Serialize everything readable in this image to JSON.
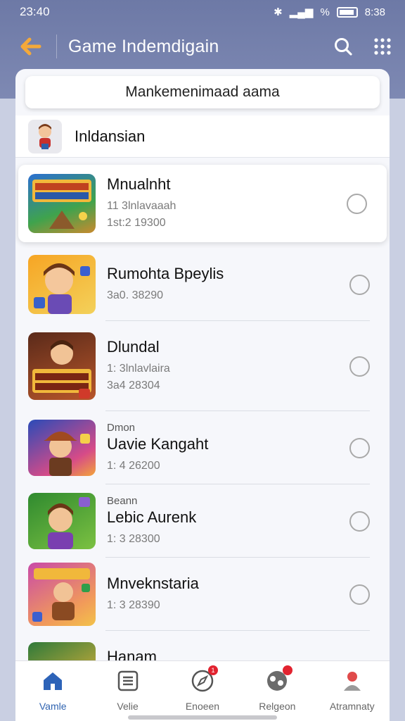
{
  "status_bar": {
    "time_left": "23:40",
    "signal_text": "%",
    "time_right": "8:38"
  },
  "app_bar": {
    "back_icon": "arrow-left-icon",
    "title": "Game Indemdigain",
    "search_icon": "search-icon",
    "grid_icon": "grid-icon",
    "accent": "#f4a93a"
  },
  "search": {
    "value": "Mankemenimaad aama"
  },
  "category": {
    "label": "Inldansian"
  },
  "games": [
    {
      "pre": "",
      "name": "Mnualnht",
      "meta1": "11 3lnlavaaah",
      "meta2": "1st:2 19300",
      "selected": true
    },
    {
      "pre": "",
      "name": "Rumohta Bpeylis",
      "meta1": "3a0. 38290",
      "meta2": "",
      "selected": false
    },
    {
      "pre": "",
      "name": "Dlundal",
      "meta1": "1: 3lnlavlaira",
      "meta2": "3a4 28304",
      "selected": false
    },
    {
      "pre": "Dmon",
      "name": "Uavie Kangaht",
      "meta1": "1: 4 26200",
      "meta2": "",
      "selected": false
    },
    {
      "pre": "Beann",
      "name": "Lebic Aurenk",
      "meta1": "1: 3 28300",
      "meta2": "",
      "selected": false
    },
    {
      "pre": "",
      "name": "Mnveknstaria",
      "meta1": "1: 3 28390",
      "meta2": "",
      "selected": false
    },
    {
      "pre": "",
      "name": "Hanam",
      "meta1": "",
      "meta2": "",
      "selected": false
    }
  ],
  "bottom_nav": [
    {
      "label": "Vamle",
      "icon": "home-icon",
      "active": true,
      "badge": ""
    },
    {
      "label": "Velie",
      "icon": "list-icon",
      "active": false,
      "badge": ""
    },
    {
      "label": "Enoeen",
      "icon": "compass-icon",
      "active": false,
      "badge": "1"
    },
    {
      "label": "Relgeon",
      "icon": "gamepad-icon",
      "active": false,
      "badge": " "
    },
    {
      "label": "Atramnaty",
      "icon": "person-icon",
      "active": false,
      "badge": ""
    }
  ]
}
